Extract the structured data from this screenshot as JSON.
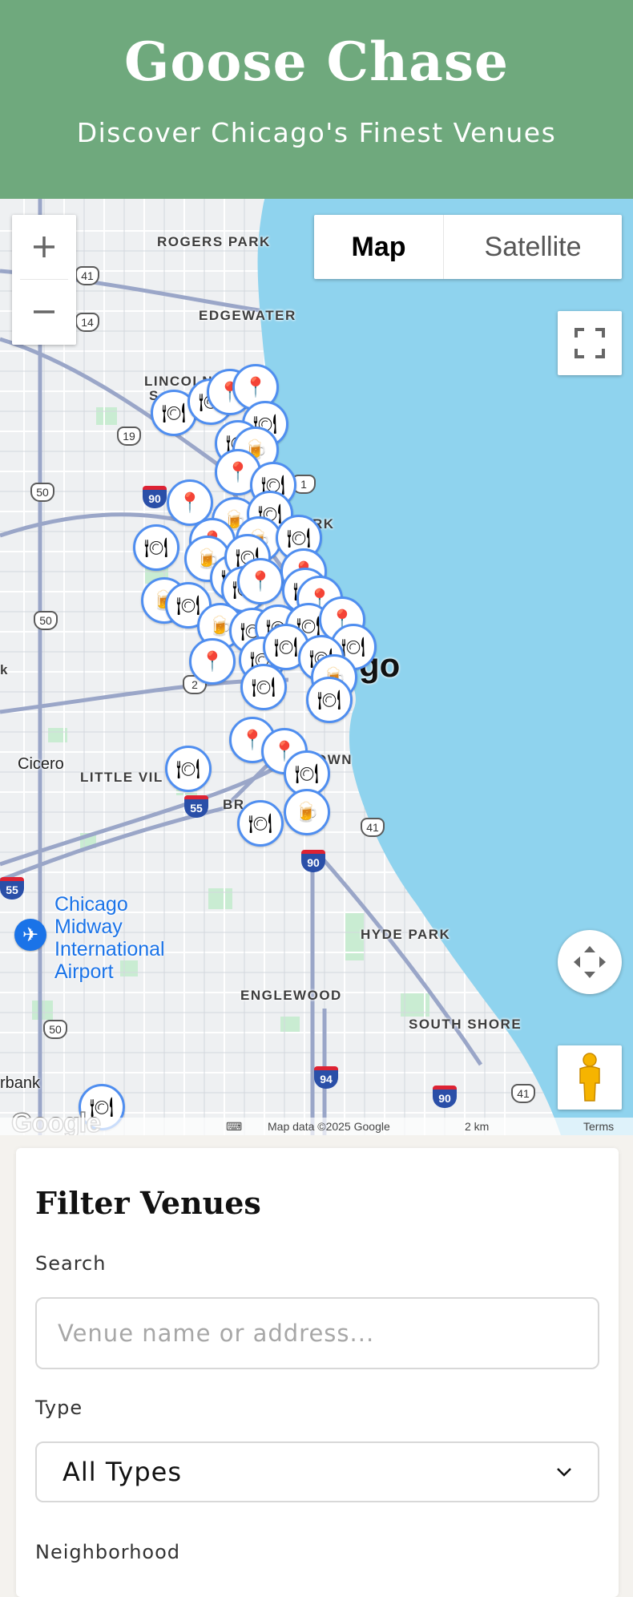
{
  "header": {
    "title": "Goose Chase",
    "subtitle": "Discover Chicago's Finest Venues"
  },
  "map": {
    "zoom_in_icon": "plus-icon",
    "zoom_out_icon": "minus-icon",
    "map_type": {
      "map_label": "Map",
      "satellite_label": "Satellite"
    },
    "labels": {
      "rogers_park": "ROGERS PARK",
      "edgewater": "EDGEWATER",
      "lincoln": "LINCOLN",
      "lincoln_s": "S",
      "little_village": "LITTLE VIL",
      "cicero": "Cicero",
      "hyde_park": "HYDE PARK",
      "englewood": "ENGLEWOOD",
      "south_shore": "SOUTH SHORE",
      "downtown": "OWN",
      "bridgeport": "BR",
      "park": "RK",
      "chicago_fragment": "go",
      "burbank": "rbank",
      "k_fragment": "k",
      "airport_line1": "Chicago",
      "airport_line2": "Midway",
      "airport_line3": "International",
      "airport_line4": "Airport"
    },
    "routes": [
      "41",
      "14",
      "19",
      "50",
      "50",
      "50",
      "90",
      "90",
      "55",
      "55",
      "94",
      "90",
      "41",
      "41",
      "1",
      "2"
    ],
    "footer": {
      "data": "Map data ©2025 Google",
      "scale": "2 km",
      "terms": "Terms"
    },
    "google_logo": "Google",
    "colors": {
      "water": "#8fd3ee",
      "land": "#eef0f2",
      "park": "#c9ecd2",
      "marker_border": "#4f8ef0"
    }
  },
  "filter": {
    "title": "Filter Venues",
    "search_label": "Search",
    "search_placeholder": "Venue name or address...",
    "type_label": "Type",
    "type_value": "All Types",
    "neighborhood_label": "Neighborhood"
  },
  "colors": {
    "header_bg": "#6fa97d",
    "page_bg": "#f4f2ee"
  }
}
